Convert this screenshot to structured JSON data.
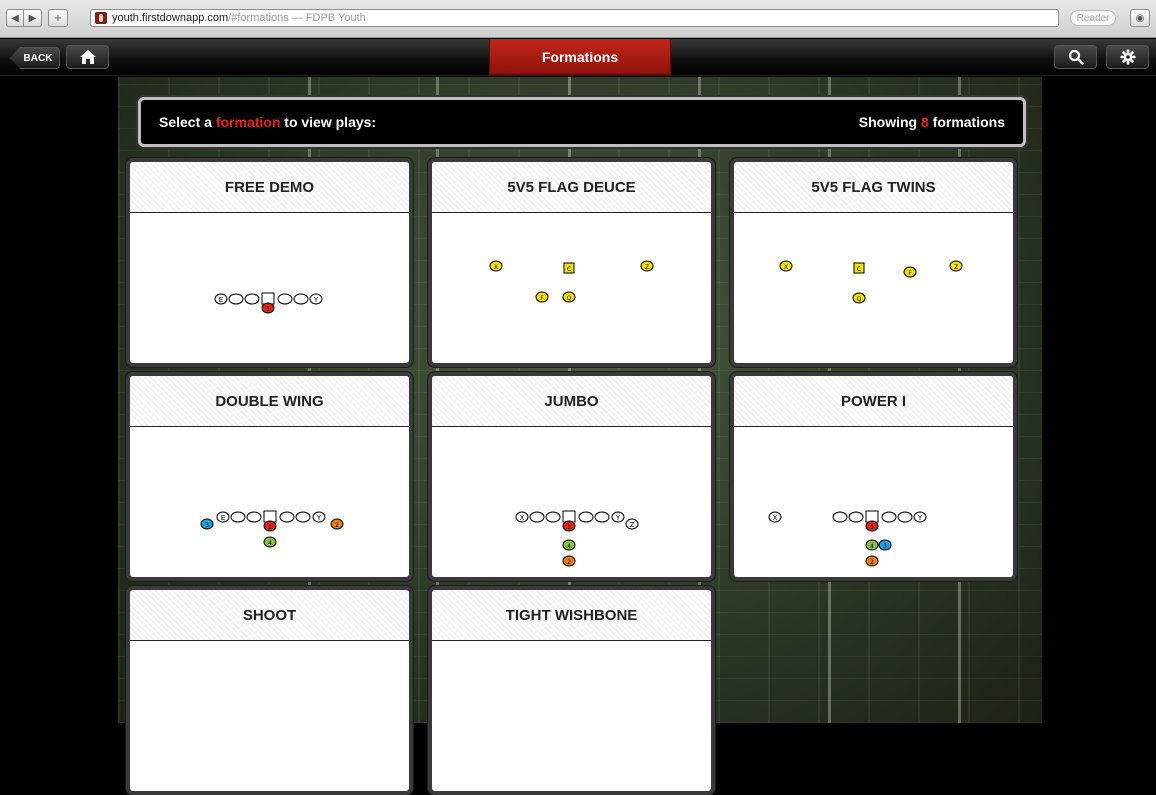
{
  "browser": {
    "url_host": "youth.firstdownapp.com",
    "url_rest": "/#formations — FDPB Youth",
    "reader_label": "Reader",
    "back_icon": "back-arrow-icon",
    "forward_icon": "forward-arrow-icon"
  },
  "app": {
    "back_label": "BACK",
    "title": "Formations"
  },
  "header": {
    "prompt_prefix": "Select a ",
    "prompt_highlight": "formation",
    "prompt_suffix": " to view plays:",
    "count_prefix": "Showing ",
    "count_value": "8",
    "count_suffix": " formations"
  },
  "colors": {
    "accent_red": "#e0261a",
    "player_yellow": "#f4e300",
    "player_blue": "#1fa4e0",
    "player_orange": "#e8801a",
    "player_green": "#8bc34a"
  },
  "formations": [
    {
      "name": "FREE DEMO",
      "players": [
        {
          "label": "E",
          "shape": "oval",
          "color": "white"
        },
        {
          "label": "",
          "shape": "oval",
          "color": "white"
        },
        {
          "label": "",
          "shape": "oval",
          "color": "white"
        },
        {
          "label": "",
          "shape": "square",
          "color": "white"
        },
        {
          "label": "",
          "shape": "oval",
          "color": "white"
        },
        {
          "label": "",
          "shape": "oval",
          "color": "white"
        },
        {
          "label": "Y",
          "shape": "oval",
          "color": "white"
        },
        {
          "label": "1",
          "shape": "oval",
          "color": "red"
        }
      ]
    },
    {
      "name": "5V5 FLAG DEUCE",
      "players": [
        {
          "label": "X",
          "shape": "oval",
          "color": "yellow"
        },
        {
          "label": "C",
          "shape": "square",
          "color": "yellow"
        },
        {
          "label": "Z",
          "shape": "oval",
          "color": "yellow"
        },
        {
          "label": "F",
          "shape": "oval",
          "color": "yellow"
        },
        {
          "label": "Q",
          "shape": "oval",
          "color": "yellow"
        }
      ]
    },
    {
      "name": "5V5 FLAG TWINS",
      "players": [
        {
          "label": "X",
          "shape": "oval",
          "color": "yellow"
        },
        {
          "label": "C",
          "shape": "square",
          "color": "yellow"
        },
        {
          "label": "F",
          "shape": "oval",
          "color": "yellow"
        },
        {
          "label": "Z",
          "shape": "oval",
          "color": "yellow"
        },
        {
          "label": "Q",
          "shape": "oval",
          "color": "yellow"
        }
      ]
    },
    {
      "name": "DOUBLE WING",
      "players": [
        {
          "label": "3",
          "shape": "oval",
          "color": "blue"
        },
        {
          "label": "E",
          "shape": "oval",
          "color": "white"
        },
        {
          "label": "",
          "shape": "oval",
          "color": "white"
        },
        {
          "label": "",
          "shape": "oval",
          "color": "white"
        },
        {
          "label": "",
          "shape": "square",
          "color": "white"
        },
        {
          "label": "",
          "shape": "oval",
          "color": "white"
        },
        {
          "label": "",
          "shape": "oval",
          "color": "white"
        },
        {
          "label": "Y",
          "shape": "oval",
          "color": "white"
        },
        {
          "label": "2",
          "shape": "oval",
          "color": "orange"
        },
        {
          "label": "1",
          "shape": "oval",
          "color": "red"
        },
        {
          "label": "4",
          "shape": "oval",
          "color": "green"
        }
      ]
    },
    {
      "name": "JUMBO",
      "players": [
        {
          "label": "X",
          "shape": "oval",
          "color": "white"
        },
        {
          "label": "",
          "shape": "oval",
          "color": "white"
        },
        {
          "label": "",
          "shape": "oval",
          "color": "white"
        },
        {
          "label": "",
          "shape": "square",
          "color": "white"
        },
        {
          "label": "",
          "shape": "oval",
          "color": "white"
        },
        {
          "label": "",
          "shape": "oval",
          "color": "white"
        },
        {
          "label": "Y",
          "shape": "oval",
          "color": "white"
        },
        {
          "label": "Z",
          "shape": "oval",
          "color": "white"
        },
        {
          "label": "1",
          "shape": "oval",
          "color": "red"
        },
        {
          "label": "4",
          "shape": "oval",
          "color": "green"
        },
        {
          "label": "2",
          "shape": "oval",
          "color": "orange"
        }
      ]
    },
    {
      "name": "POWER I",
      "players": [
        {
          "label": "X",
          "shape": "oval",
          "color": "white"
        },
        {
          "label": "",
          "shape": "oval",
          "color": "white"
        },
        {
          "label": "",
          "shape": "oval",
          "color": "white"
        },
        {
          "label": "",
          "shape": "square",
          "color": "white"
        },
        {
          "label": "",
          "shape": "oval",
          "color": "white"
        },
        {
          "label": "",
          "shape": "oval",
          "color": "white"
        },
        {
          "label": "Y",
          "shape": "oval",
          "color": "white"
        },
        {
          "label": "1",
          "shape": "oval",
          "color": "red"
        },
        {
          "label": "4",
          "shape": "oval",
          "color": "green"
        },
        {
          "label": "3",
          "shape": "oval",
          "color": "blue"
        },
        {
          "label": "2",
          "shape": "oval",
          "color": "orange"
        }
      ]
    },
    {
      "name": "SHOOT",
      "players": []
    },
    {
      "name": "TIGHT WISHBONE",
      "players": []
    }
  ]
}
